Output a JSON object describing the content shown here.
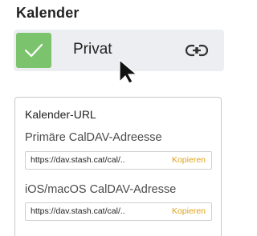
{
  "section": {
    "title": "Kalender"
  },
  "calendar": {
    "name": "Privat",
    "checked": true,
    "check_color": "#7cc36d",
    "check_icon": "checkmark-icon",
    "link_icon": "link-icon"
  },
  "url_panel": {
    "title": "Kalender-URL",
    "caldav": {
      "label": "Primäre CalDAV-Adreesse",
      "value": "https://dav.stash.cat/cal/..",
      "copy_label": "Kopieren"
    },
    "ios": {
      "label": "iOS/macOS CalDAV-Adresse",
      "value": "https://dav.stash.cat/cal/..",
      "copy_label": "Kopieren"
    }
  },
  "colors": {
    "accent": "#e0a21b",
    "row_background": "#eceef1"
  }
}
